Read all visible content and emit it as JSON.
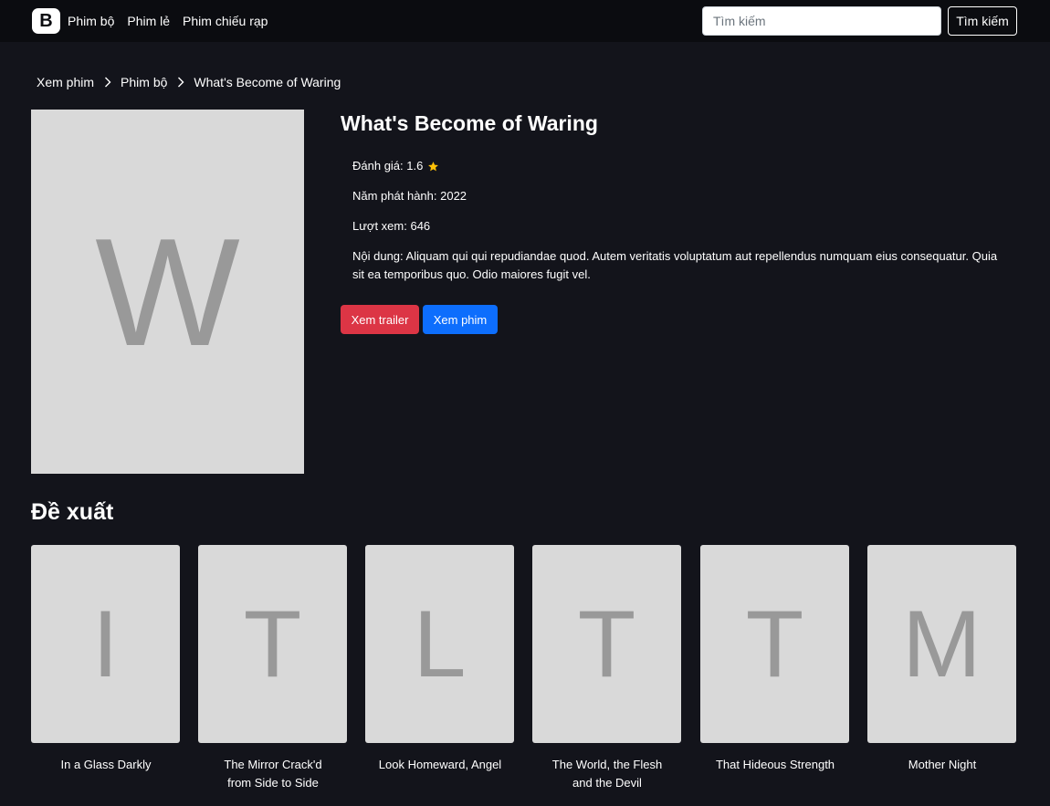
{
  "navbar": {
    "brand_letter": "B",
    "links": [
      "Phim bộ",
      "Phim lẻ",
      "Phim chiếu rạp"
    ],
    "search_placeholder": "Tìm kiếm",
    "search_button": "Tìm kiếm"
  },
  "breadcrumb": [
    "Xem phim",
    "Phim bộ",
    "What's Become of Waring"
  ],
  "movie": {
    "poster_letter": "W",
    "title": "What's Become of Waring",
    "rating_text": "Đánh giá: 1.6",
    "year_text": "Năm phát hành: 2022",
    "views_text": "Lượt xem: 646",
    "description_text": "Nội dung: Aliquam qui qui repudiandae quod. Autem veritatis voluptatum aut repellendus numquam eius consequatur. Quia sit ea temporibus quo. Odio maiores fugit vel.",
    "trailer_button": "Xem trailer",
    "watch_button": "Xem phim"
  },
  "suggestions": {
    "title": "Đề xuất",
    "items": [
      {
        "letter": "I",
        "title": "In a Glass Darkly"
      },
      {
        "letter": "T",
        "title": "The Mirror Crack'd from Side to Side"
      },
      {
        "letter": "L",
        "title": "Look Homeward, Angel"
      },
      {
        "letter": "T",
        "title": "The World, the Flesh and the Devil"
      },
      {
        "letter": "T",
        "title": "That Hideous Strength"
      },
      {
        "letter": "M",
        "title": "Mother Night"
      }
    ]
  },
  "colors": {
    "background": "#13141b",
    "navbar": "#0b0c10",
    "danger": "#dc3545",
    "primary": "#0d6efd",
    "star": "#ffc107"
  },
  "icons": {
    "brand": "bootstrap-logo-icon",
    "breadcrumb_separator": "chevron-right-icon",
    "rating": "star-icon"
  }
}
